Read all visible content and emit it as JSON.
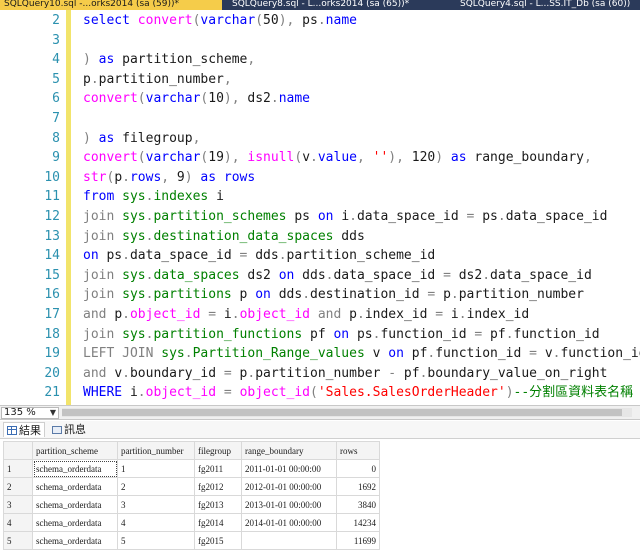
{
  "tabs": [
    {
      "label": "SQLQuery10.sql -...orks2014 (sa (59))*",
      "active": true
    },
    {
      "label": "SQLQuery8.sql - L...orks2014 (sa (65))*",
      "active": false
    },
    {
      "label": "SQLQuery4.sql - L...SS.IT_Db (sa (60))",
      "active": false
    }
  ],
  "editor": {
    "lines": [
      {
        "n": "2",
        "tokens": [
          {
            "t": "select ",
            "c": "k"
          },
          {
            "t": "convert",
            "c": "f"
          },
          {
            "t": "(",
            "c": "g"
          },
          {
            "t": "varchar",
            "c": "k"
          },
          {
            "t": "(",
            "c": "g"
          },
          {
            "t": "50",
            "c": "t"
          },
          {
            "t": "),",
            "c": "g"
          },
          {
            "t": " ps",
            "c": "t"
          },
          {
            "t": ".",
            "c": "g"
          },
          {
            "t": "name",
            "c": "k"
          }
        ]
      },
      {
        "n": "3",
        "tokens": []
      },
      {
        "n": "4",
        "tokens": [
          {
            "t": ") ",
            "c": "g"
          },
          {
            "t": "as ",
            "c": "k"
          },
          {
            "t": "partition_scheme",
            "c": "t"
          },
          {
            "t": ",",
            "c": "g"
          }
        ]
      },
      {
        "n": "5",
        "tokens": [
          {
            "t": "p",
            "c": "t"
          },
          {
            "t": ".",
            "c": "g"
          },
          {
            "t": "partition_number",
            "c": "t"
          },
          {
            "t": ",",
            "c": "g"
          }
        ]
      },
      {
        "n": "6",
        "tokens": [
          {
            "t": "convert",
            "c": "f"
          },
          {
            "t": "(",
            "c": "g"
          },
          {
            "t": "varchar",
            "c": "k"
          },
          {
            "t": "(",
            "c": "g"
          },
          {
            "t": "10",
            "c": "t"
          },
          {
            "t": "),",
            "c": "g"
          },
          {
            "t": " ds2",
            "c": "t"
          },
          {
            "t": ".",
            "c": "g"
          },
          {
            "t": "name",
            "c": "k"
          }
        ]
      },
      {
        "n": "7",
        "tokens": []
      },
      {
        "n": "8",
        "tokens": [
          {
            "t": ") ",
            "c": "g"
          },
          {
            "t": "as ",
            "c": "k"
          },
          {
            "t": "filegroup",
            "c": "t"
          },
          {
            "t": ",",
            "c": "g"
          }
        ]
      },
      {
        "n": "9",
        "tokens": [
          {
            "t": "convert",
            "c": "f"
          },
          {
            "t": "(",
            "c": "g"
          },
          {
            "t": "varchar",
            "c": "k"
          },
          {
            "t": "(",
            "c": "g"
          },
          {
            "t": "19",
            "c": "t"
          },
          {
            "t": "),",
            "c": "g"
          },
          {
            "t": " ",
            "c": "t"
          },
          {
            "t": "isnull",
            "c": "f"
          },
          {
            "t": "(",
            "c": "g"
          },
          {
            "t": "v",
            "c": "t"
          },
          {
            "t": ".",
            "c": "g"
          },
          {
            "t": "value",
            "c": "k"
          },
          {
            "t": ",",
            "c": "g"
          },
          {
            "t": " ",
            "c": "t"
          },
          {
            "t": "''",
            "c": "r"
          },
          {
            "t": "),",
            "c": "g"
          },
          {
            "t": " 120",
            "c": "t"
          },
          {
            "t": ")",
            "c": "g"
          },
          {
            "t": " as ",
            "c": "k"
          },
          {
            "t": "range_boundary",
            "c": "t"
          },
          {
            "t": ",",
            "c": "g"
          }
        ]
      },
      {
        "n": "10",
        "tokens": [
          {
            "t": "str",
            "c": "f"
          },
          {
            "t": "(",
            "c": "g"
          },
          {
            "t": "p",
            "c": "t"
          },
          {
            "t": ".",
            "c": "g"
          },
          {
            "t": "rows",
            "c": "k"
          },
          {
            "t": ",",
            "c": "g"
          },
          {
            "t": " 9",
            "c": "t"
          },
          {
            "t": ")",
            "c": "g"
          },
          {
            "t": " as ",
            "c": "k"
          },
          {
            "t": "rows",
            "c": "k"
          }
        ]
      },
      {
        "n": "11",
        "tokens": [
          {
            "t": "from ",
            "c": "k"
          },
          {
            "t": "sys",
            "c": "s"
          },
          {
            "t": ".",
            "c": "g"
          },
          {
            "t": "indexes",
            "c": "s"
          },
          {
            "t": " i",
            "c": "t"
          }
        ]
      },
      {
        "n": "12",
        "tokens": [
          {
            "t": "join ",
            "c": "g"
          },
          {
            "t": "sys",
            "c": "s"
          },
          {
            "t": ".",
            "c": "g"
          },
          {
            "t": "partition_schemes",
            "c": "s"
          },
          {
            "t": " ps ",
            "c": "t"
          },
          {
            "t": "on ",
            "c": "k"
          },
          {
            "t": "i",
            "c": "t"
          },
          {
            "t": ".",
            "c": "g"
          },
          {
            "t": "data_space_id ",
            "c": "t"
          },
          {
            "t": "= ",
            "c": "g"
          },
          {
            "t": "ps",
            "c": "t"
          },
          {
            "t": ".",
            "c": "g"
          },
          {
            "t": "data_space_id",
            "c": "t"
          }
        ]
      },
      {
        "n": "13",
        "tokens": [
          {
            "t": "join ",
            "c": "g"
          },
          {
            "t": "sys",
            "c": "s"
          },
          {
            "t": ".",
            "c": "g"
          },
          {
            "t": "destination_data_spaces",
            "c": "s"
          },
          {
            "t": " dds",
            "c": "t"
          }
        ]
      },
      {
        "n": "14",
        "tokens": [
          {
            "t": "on ",
            "c": "k"
          },
          {
            "t": "ps",
            "c": "t"
          },
          {
            "t": ".",
            "c": "g"
          },
          {
            "t": "data_space_id ",
            "c": "t"
          },
          {
            "t": "= ",
            "c": "g"
          },
          {
            "t": "dds",
            "c": "t"
          },
          {
            "t": ".",
            "c": "g"
          },
          {
            "t": "partition_scheme_id",
            "c": "t"
          }
        ]
      },
      {
        "n": "15",
        "tokens": [
          {
            "t": "join ",
            "c": "g"
          },
          {
            "t": "sys",
            "c": "s"
          },
          {
            "t": ".",
            "c": "g"
          },
          {
            "t": "data_spaces",
            "c": "s"
          },
          {
            "t": " ds2 ",
            "c": "t"
          },
          {
            "t": "on ",
            "c": "k"
          },
          {
            "t": "dds",
            "c": "t"
          },
          {
            "t": ".",
            "c": "g"
          },
          {
            "t": "data_space_id ",
            "c": "t"
          },
          {
            "t": "= ",
            "c": "g"
          },
          {
            "t": "ds2",
            "c": "t"
          },
          {
            "t": ".",
            "c": "g"
          },
          {
            "t": "data_space_id",
            "c": "t"
          }
        ]
      },
      {
        "n": "16",
        "tokens": [
          {
            "t": "join ",
            "c": "g"
          },
          {
            "t": "sys",
            "c": "s"
          },
          {
            "t": ".",
            "c": "g"
          },
          {
            "t": "partitions",
            "c": "s"
          },
          {
            "t": " p ",
            "c": "t"
          },
          {
            "t": "on ",
            "c": "k"
          },
          {
            "t": "dds",
            "c": "t"
          },
          {
            "t": ".",
            "c": "g"
          },
          {
            "t": "destination_id ",
            "c": "t"
          },
          {
            "t": "= ",
            "c": "g"
          },
          {
            "t": "p",
            "c": "t"
          },
          {
            "t": ".",
            "c": "g"
          },
          {
            "t": "partition_number",
            "c": "t"
          }
        ]
      },
      {
        "n": "17",
        "tokens": [
          {
            "t": "and ",
            "c": "g"
          },
          {
            "t": "p",
            "c": "t"
          },
          {
            "t": ".",
            "c": "g"
          },
          {
            "t": "object_id ",
            "c": "f"
          },
          {
            "t": "= ",
            "c": "g"
          },
          {
            "t": "i",
            "c": "t"
          },
          {
            "t": ".",
            "c": "g"
          },
          {
            "t": "object_id ",
            "c": "f"
          },
          {
            "t": "and ",
            "c": "g"
          },
          {
            "t": "p",
            "c": "t"
          },
          {
            "t": ".",
            "c": "g"
          },
          {
            "t": "index_id ",
            "c": "t"
          },
          {
            "t": "= ",
            "c": "g"
          },
          {
            "t": "i",
            "c": "t"
          },
          {
            "t": ".",
            "c": "g"
          },
          {
            "t": "index_id",
            "c": "t"
          }
        ]
      },
      {
        "n": "18",
        "tokens": [
          {
            "t": "join ",
            "c": "g"
          },
          {
            "t": "sys",
            "c": "s"
          },
          {
            "t": ".",
            "c": "g"
          },
          {
            "t": "partition_functions",
            "c": "s"
          },
          {
            "t": " pf ",
            "c": "t"
          },
          {
            "t": "on ",
            "c": "k"
          },
          {
            "t": "ps",
            "c": "t"
          },
          {
            "t": ".",
            "c": "g"
          },
          {
            "t": "function_id ",
            "c": "t"
          },
          {
            "t": "= ",
            "c": "g"
          },
          {
            "t": "pf",
            "c": "t"
          },
          {
            "t": ".",
            "c": "g"
          },
          {
            "t": "function_id",
            "c": "t"
          }
        ]
      },
      {
        "n": "19",
        "tokens": [
          {
            "t": "LEFT JOIN ",
            "c": "g"
          },
          {
            "t": "sys",
            "c": "s"
          },
          {
            "t": ".",
            "c": "g"
          },
          {
            "t": "Partition_Range_values",
            "c": "s"
          },
          {
            "t": " v ",
            "c": "t"
          },
          {
            "t": "on ",
            "c": "k"
          },
          {
            "t": "pf",
            "c": "t"
          },
          {
            "t": ".",
            "c": "g"
          },
          {
            "t": "function_id ",
            "c": "t"
          },
          {
            "t": "= ",
            "c": "g"
          },
          {
            "t": "v",
            "c": "t"
          },
          {
            "t": ".",
            "c": "g"
          },
          {
            "t": "function_id",
            "c": "t"
          }
        ]
      },
      {
        "n": "20",
        "tokens": [
          {
            "t": "and ",
            "c": "g"
          },
          {
            "t": "v",
            "c": "t"
          },
          {
            "t": ".",
            "c": "g"
          },
          {
            "t": "boundary_id ",
            "c": "t"
          },
          {
            "t": "= ",
            "c": "g"
          },
          {
            "t": "p",
            "c": "t"
          },
          {
            "t": ".",
            "c": "g"
          },
          {
            "t": "partition_number ",
            "c": "t"
          },
          {
            "t": "- ",
            "c": "g"
          },
          {
            "t": "pf",
            "c": "t"
          },
          {
            "t": ".",
            "c": "g"
          },
          {
            "t": "boundary_value_on_right",
            "c": "t"
          }
        ]
      },
      {
        "n": "21",
        "tokens": [
          {
            "t": "WHERE ",
            "c": "k"
          },
          {
            "t": "i",
            "c": "t"
          },
          {
            "t": ".",
            "c": "g"
          },
          {
            "t": "object_id ",
            "c": "f"
          },
          {
            "t": "= ",
            "c": "g"
          },
          {
            "t": "object_id",
            "c": "f"
          },
          {
            "t": "(",
            "c": "g"
          },
          {
            "t": "'Sales.SalesOrderHeader'",
            "c": "r"
          },
          {
            "t": ")",
            "c": "g"
          },
          {
            "t": "--分割區資料表名稱",
            "c": "c"
          }
        ]
      }
    ]
  },
  "zoom": {
    "value": "135 %"
  },
  "results_tabs": [
    {
      "label": "結果",
      "icon": "grid-icon",
      "active": true
    },
    {
      "label": "訊息",
      "icon": "message-icon",
      "active": false
    }
  ],
  "results": {
    "columns": [
      "partition_scheme",
      "partition_number",
      "filegroup",
      "range_boundary",
      "rows"
    ],
    "rows": [
      {
        "n": "1",
        "cells": [
          "schema_orderdata",
          "1",
          "fg2011",
          "2011-01-01 00:00:00",
          "0"
        ]
      },
      {
        "n": "2",
        "cells": [
          "schema_orderdata",
          "2",
          "fg2012",
          "2012-01-01 00:00:00",
          "1692"
        ]
      },
      {
        "n": "3",
        "cells": [
          "schema_orderdata",
          "3",
          "fg2013",
          "2013-01-01 00:00:00",
          "3840"
        ]
      },
      {
        "n": "4",
        "cells": [
          "schema_orderdata",
          "4",
          "fg2014",
          "2014-01-01 00:00:00",
          "14234"
        ]
      },
      {
        "n": "5",
        "cells": [
          "schema_orderdata",
          "5",
          "fg2015",
          "",
          "11699"
        ]
      }
    ]
  },
  "colors": {
    "tab_active": "#f5cc4a",
    "tab_strip": "#2b3a5a",
    "keyword": "#0000ff",
    "function": "#ff00ff",
    "system_object": "#008000",
    "string": "#ff0000",
    "line_number": "#2b91af"
  }
}
